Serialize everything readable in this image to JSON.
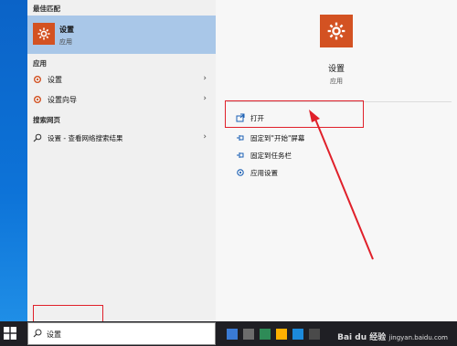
{
  "left": {
    "best_match_title": "最佳匹配",
    "best_match": {
      "name": "设置",
      "type": "应用"
    },
    "apps_title": "应用",
    "apps": [
      {
        "label": "设置"
      },
      {
        "label": "设置向导"
      }
    ],
    "web_title": "搜索网页",
    "web_item": "设置 - 查看网络搜索结果"
  },
  "right": {
    "app_name": "设置",
    "app_type": "应用",
    "actions": [
      {
        "label": "打开",
        "icon": "open-icon"
      },
      {
        "label": "固定到\"开始\"屏幕",
        "icon": "pin-icon"
      },
      {
        "label": "固定到任务栏",
        "icon": "pin-icon"
      },
      {
        "label": "应用设置",
        "icon": "gear-icon"
      }
    ]
  },
  "taskbar": {
    "search_value": "设置"
  },
  "watermark": {
    "brand": "Bai du 经验",
    "url": "jingyan.baidu.com"
  },
  "colors": {
    "accent": "#d35222",
    "selection": "#a9c7e8",
    "annotation": "#e0202a",
    "taskbar": "#1f1f24"
  }
}
